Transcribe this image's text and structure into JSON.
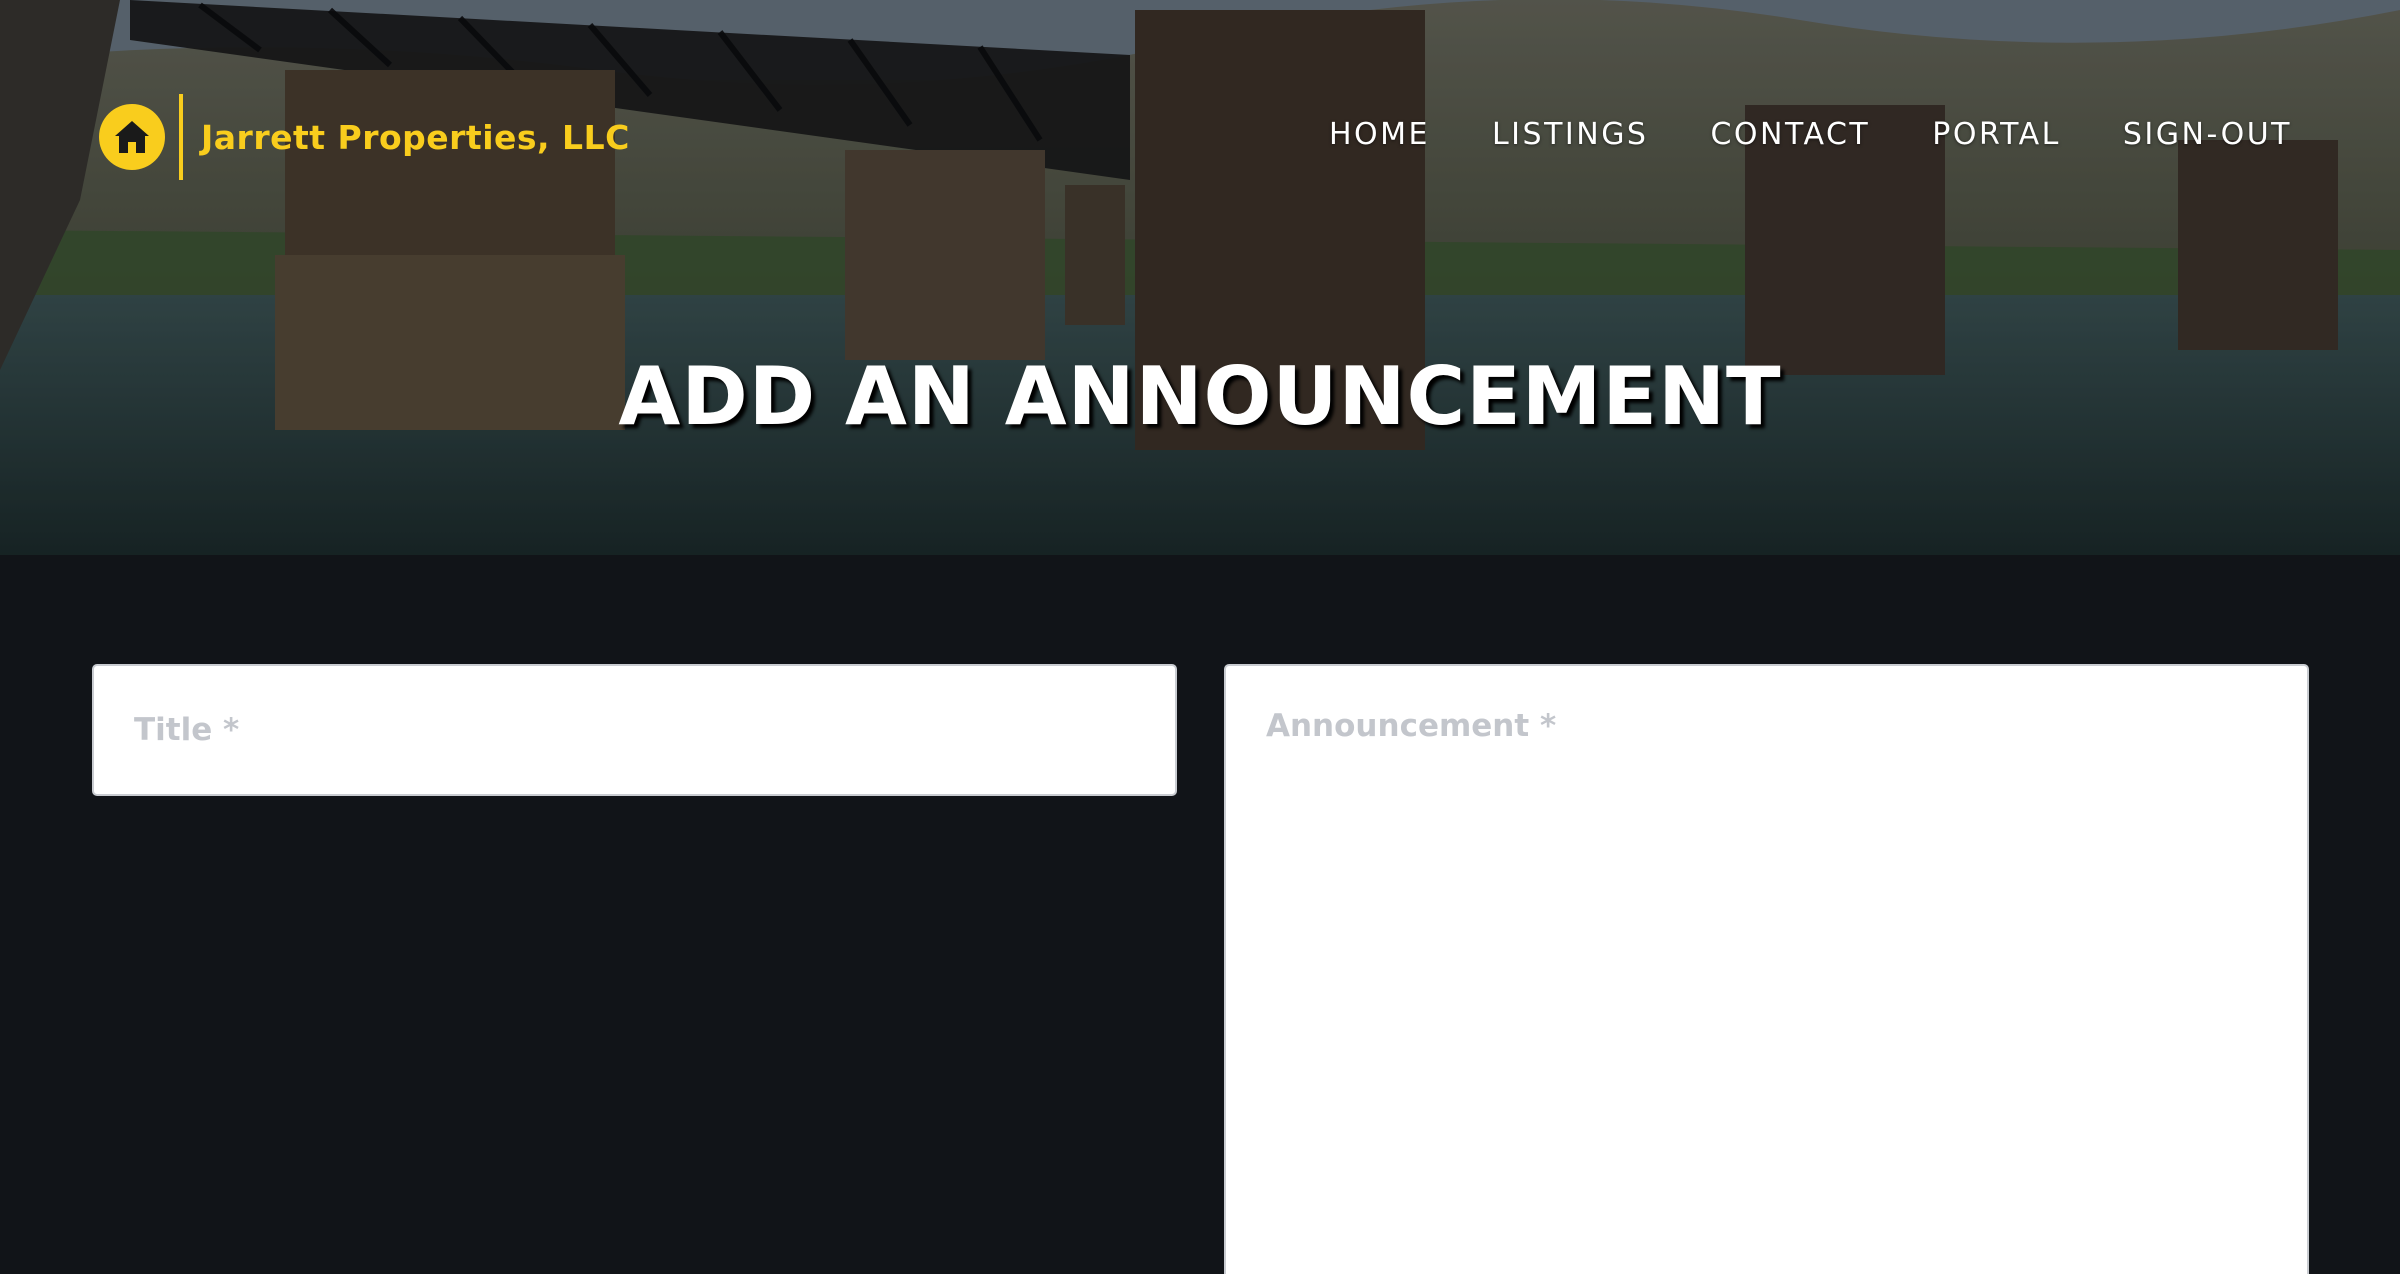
{
  "page": {
    "title": "ADD AN ANNOUNCEMENT"
  },
  "brand": {
    "name": "Jarrett Properties, LLC",
    "icon": "home-icon",
    "color": "#f9cd1d"
  },
  "nav": {
    "items": [
      {
        "label": "HOME"
      },
      {
        "label": "LISTINGS"
      },
      {
        "label": "CONTACT"
      },
      {
        "label": "PORTAL"
      },
      {
        "label": "SIGN-OUT"
      }
    ]
  },
  "form": {
    "title_field": {
      "value": "",
      "placeholder": "Title *"
    },
    "announcement_field": {
      "value": "",
      "placeholder": "Announcement *"
    }
  },
  "colors": {
    "background": "#111418",
    "accent": "#f9cd1d",
    "field_background": "#ffffff",
    "placeholder": "#c3c6cc"
  }
}
